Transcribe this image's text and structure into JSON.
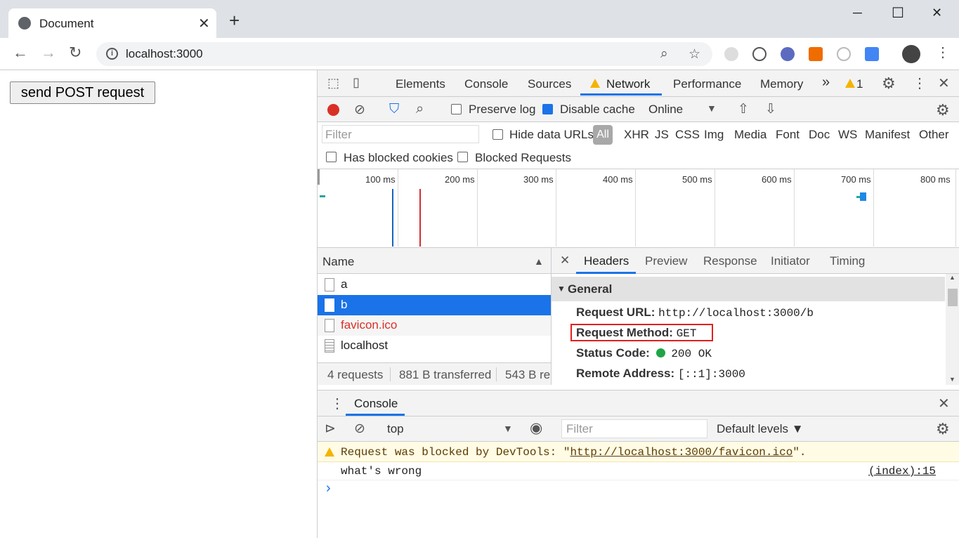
{
  "browser": {
    "tab_title": "Document",
    "tab_close": "✕",
    "new_tab": "+",
    "url": "localhost:3000",
    "window_controls": {
      "minimize": "─",
      "maximize": "☐",
      "close": "✕"
    }
  },
  "page": {
    "button_label": "send POST request"
  },
  "devtools": {
    "tabs": [
      "Elements",
      "Console",
      "Sources",
      "Network",
      "Performance",
      "Memory"
    ],
    "more_tabs": "»",
    "warning_count": "1",
    "network_toolbar": {
      "preserve_log": "Preserve log",
      "disable_cache": "Disable cache",
      "throttling": "Online"
    },
    "filter": {
      "placeholder": "Filter",
      "hide_data_urls": "Hide data URLs",
      "types": [
        "All",
        "XHR",
        "JS",
        "CSS",
        "Img",
        "Media",
        "Font",
        "Doc",
        "WS",
        "Manifest",
        "Other"
      ],
      "has_blocked_cookies": "Has blocked cookies",
      "blocked_requests": "Blocked Requests"
    },
    "timeline_ticks": [
      "100 ms",
      "200 ms",
      "300 ms",
      "400 ms",
      "500 ms",
      "600 ms",
      "700 ms",
      "800 ms"
    ],
    "requests": {
      "column": "Name",
      "rows": [
        {
          "name": "a"
        },
        {
          "name": "b"
        },
        {
          "name": "favicon.ico"
        },
        {
          "name": "localhost"
        }
      ],
      "summary": {
        "count": "4 requests",
        "transferred": "881 B transferred",
        "resources": "543 B re"
      }
    },
    "headers_pane": {
      "tabs": [
        "Headers",
        "Preview",
        "Response",
        "Initiator",
        "Timing"
      ],
      "section": "General",
      "fields": [
        {
          "key": "Request URL:",
          "value": "http://localhost:3000/b"
        },
        {
          "key": "Request Method:",
          "value": "GET"
        },
        {
          "key": "Status Code:",
          "value": "200 OK"
        },
        {
          "key": "Remote Address:",
          "value": "[::1]:3000"
        }
      ]
    },
    "console": {
      "tab": "Console",
      "context": "top",
      "filter_placeholder": "Filter",
      "levels": "Default levels ▼",
      "warning_prefix": "Request was blocked by DevTools: \"",
      "warning_url": "http://localhost:3000/favicon.ico",
      "warning_suffix": "\".",
      "log_message": "what's wrong",
      "log_source": "(index):15",
      "prompt": "›"
    }
  }
}
